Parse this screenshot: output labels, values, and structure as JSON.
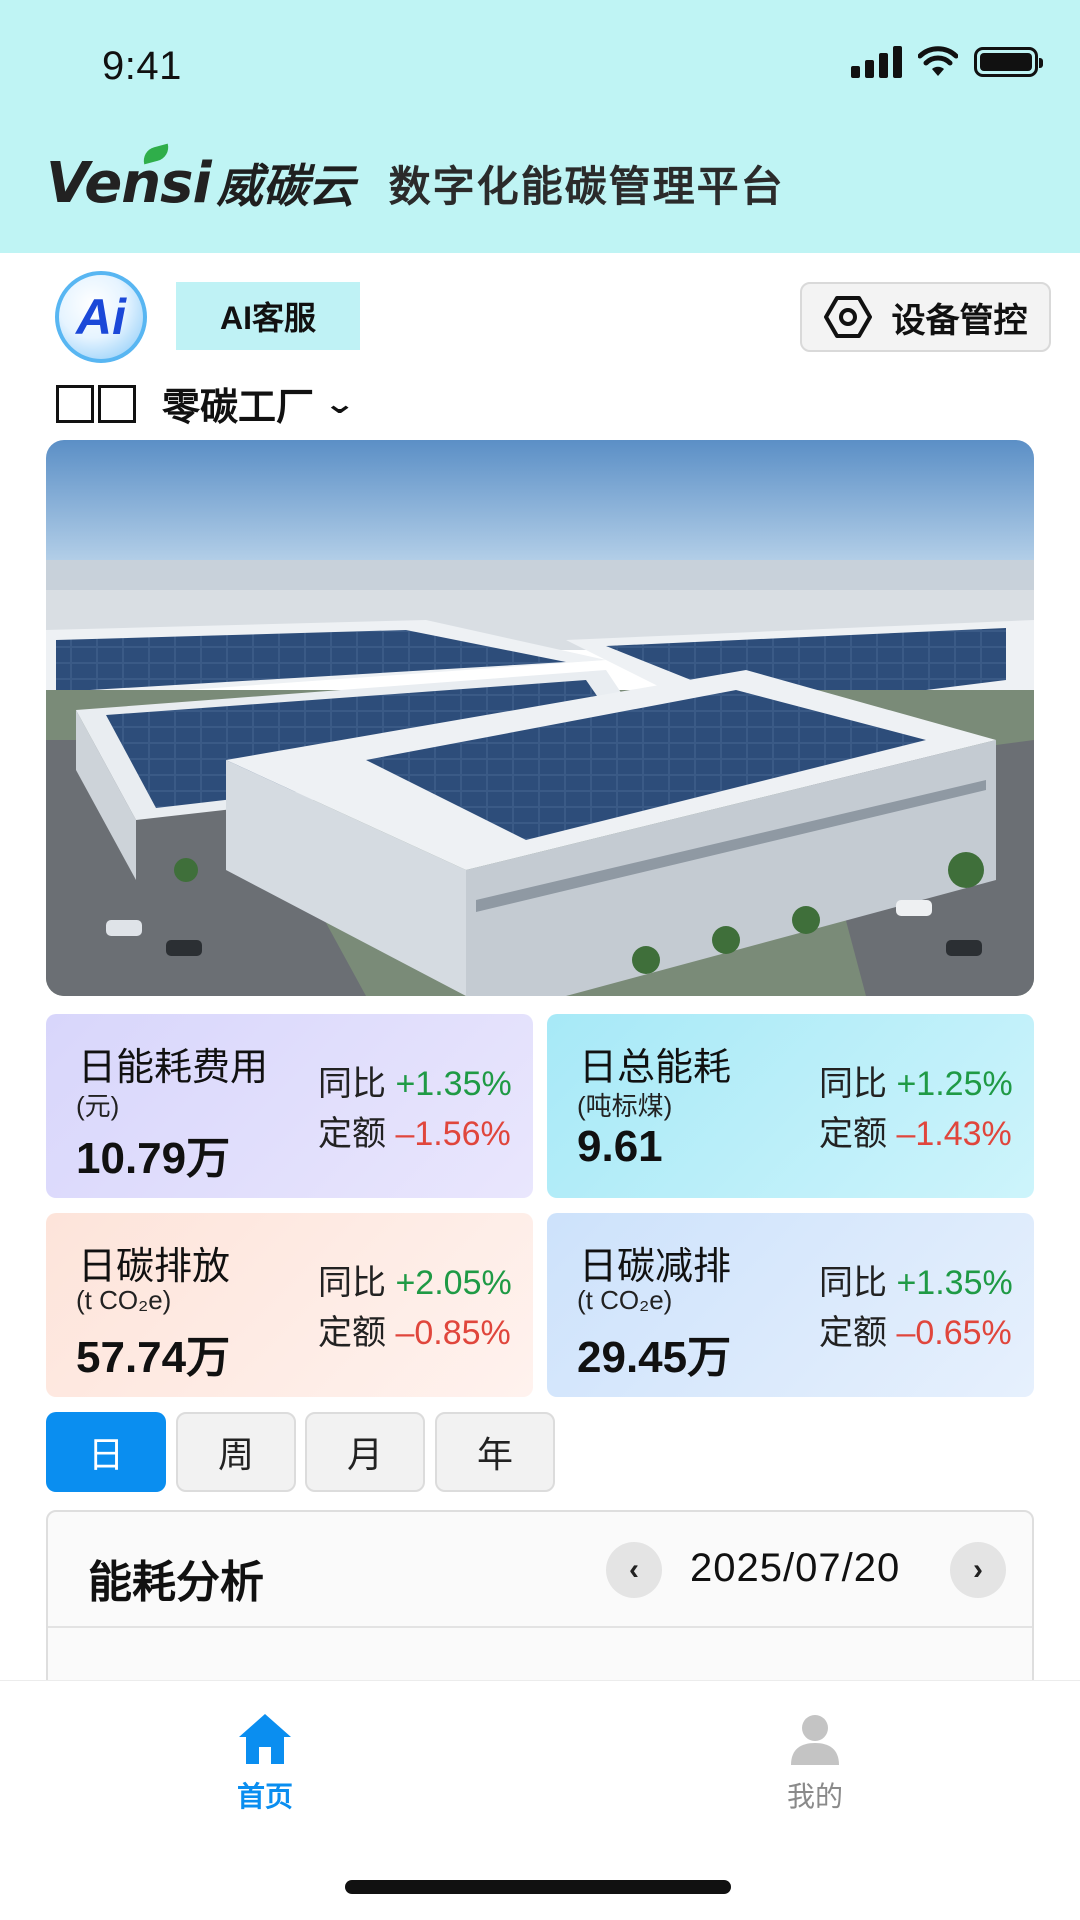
{
  "status_bar": {
    "time": "9:41"
  },
  "header": {
    "brand_latin": "Vensi",
    "brand_cn": "威碳云",
    "platform_title": "数字化能碳管理平台"
  },
  "actions": {
    "ai_avatar_text": "Ai",
    "ai_service_label": "AI客服",
    "device_control_label": "设备管控",
    "device_icon": "hexagon-gear-icon"
  },
  "factory": {
    "name": "零碳工厂",
    "icon": "chevron-down-icon"
  },
  "metrics": [
    {
      "title": "日能耗费用",
      "unit": "(元)",
      "value": "10.79万",
      "yoy_label": "同比",
      "yoy_value": "+1.35%",
      "quota_label": "定额",
      "quota_value": "–1.56%"
    },
    {
      "title": "日总能耗",
      "unit": "(吨标煤)",
      "value": "9.61",
      "yoy_label": "同比",
      "yoy_value": "+1.25%",
      "quota_label": "定额",
      "quota_value": "–1.43%"
    },
    {
      "title": "日碳排放",
      "unit": "(t CO₂e)",
      "value": "57.74万",
      "yoy_label": "同比",
      "yoy_value": "+2.05%",
      "quota_label": "定额",
      "quota_value": "–0.85%"
    },
    {
      "title": "日碳减排",
      "unit": "(t CO₂e)",
      "value": "29.45万",
      "yoy_label": "同比",
      "yoy_value": "+1.35%",
      "quota_label": "定额",
      "quota_value": "–0.65%"
    }
  ],
  "period_tabs": [
    {
      "label": "日",
      "active": true
    },
    {
      "label": "周",
      "active": false
    },
    {
      "label": "月",
      "active": false
    },
    {
      "label": "年",
      "active": false
    }
  ],
  "analysis": {
    "title": "能耗分析",
    "date": "2025/07/20",
    "prev_icon": "chevron-left-icon",
    "next_icon": "chevron-right-icon"
  },
  "tabbar": {
    "items": [
      {
        "label": "首页",
        "icon": "home-icon",
        "active": true
      },
      {
        "label": "我的",
        "icon": "user-icon",
        "active": false
      }
    ]
  },
  "colors": {
    "header_bg": "#bff4f4",
    "accent": "#0a8ef0",
    "up": "#1f9a45",
    "down": "#e0463c"
  }
}
